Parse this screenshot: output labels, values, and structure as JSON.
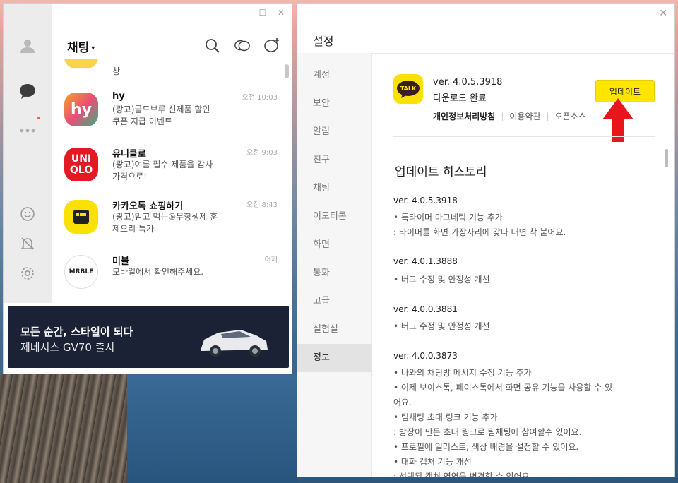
{
  "kakao": {
    "title": "채팅",
    "title_caret": "▾",
    "window_controls": [
      "—",
      "☐",
      "✕"
    ],
    "chats": [
      {
        "name": "",
        "preview": "창",
        "time": ""
      },
      {
        "name": "hy",
        "preview_line1": "(광고)콜드브루 신제품 할인",
        "preview_line2": "쿠폰 지급 이벤트",
        "time": "오전 10:03"
      },
      {
        "name": "유니클로",
        "preview_line1": "(광고)여름 필수 제품을 감사",
        "preview_line2": "가격으로!",
        "time": "오전 9:03"
      },
      {
        "name": "카카오톡 쇼핑하기",
        "preview_line1": "(광고)믿고 먹는⑤무항생제 훈",
        "preview_line2": "제오리 특가",
        "time": "오전 8:43"
      },
      {
        "name": "미블",
        "preview_line1": "모바일에서 확인해주세요.",
        "preview_line2": "",
        "time": "어제"
      }
    ],
    "avatar_labels": {
      "hy": "hy",
      "uniqlo_top": "UNI",
      "uniqlo_bottom": "QLO",
      "mrble": "MRBLE"
    },
    "ad": {
      "line1": "모든 순간, 스타일이 되다",
      "line2": "제네시스 GV70 출시"
    }
  },
  "settings": {
    "title": "설정",
    "close": "✕",
    "sidebar": [
      "계정",
      "보안",
      "알림",
      "친구",
      "채팅",
      "이모티콘",
      "화면",
      "통화",
      "고급",
      "실험실",
      "정보"
    ],
    "active_index": 10,
    "app_logo_text": "TALK",
    "version": "ver. 4.0.5.3918",
    "download_status": "다운로드 완료",
    "links": {
      "privacy": "개인정보처리방침",
      "terms": "이용약관",
      "opensource": "오픈소스"
    },
    "update_button": "업데이트",
    "history_title": "업데이트 히스토리",
    "history": [
      {
        "ver": "ver. 4.0.5.3918",
        "notes": [
          "• 톡타이머 마그네틱 기능 추가",
          ": 타이머를 화면 가장자리에 갖다 대면 착 붙어요."
        ]
      },
      {
        "ver": "ver. 4.0.1.3888",
        "notes": [
          "• 버그 수정 및 안정성 개선"
        ]
      },
      {
        "ver": "ver. 4.0.0.3881",
        "notes": [
          "• 버그 수정 및 안정성 개선"
        ]
      },
      {
        "ver": "ver. 4.0.0.3873",
        "notes": [
          "• 나와의 채팅방 메시지 수정 기능 추가",
          "• 이제 보이스톡, 페이스톡에서 화면 공유 기능을 사용할 수 있",
          "어요.",
          "• 팀채팅 초대 링크 기능 추가",
          ": 방장이 만든 초대 링크로 팀채팅에 참여할수 있어요.",
          "• 프로필에 일러스트, 색상 배경을 설정할 수 있어요.",
          "• 대화 캡처 기능 개선",
          ": 선택된 캡처 영역을 변경할 수 있어요."
        ]
      }
    ]
  },
  "colors": {
    "kakao_yellow": "#fee500",
    "arrow_red": "#e8161b",
    "ad_background": "#1b2235"
  }
}
